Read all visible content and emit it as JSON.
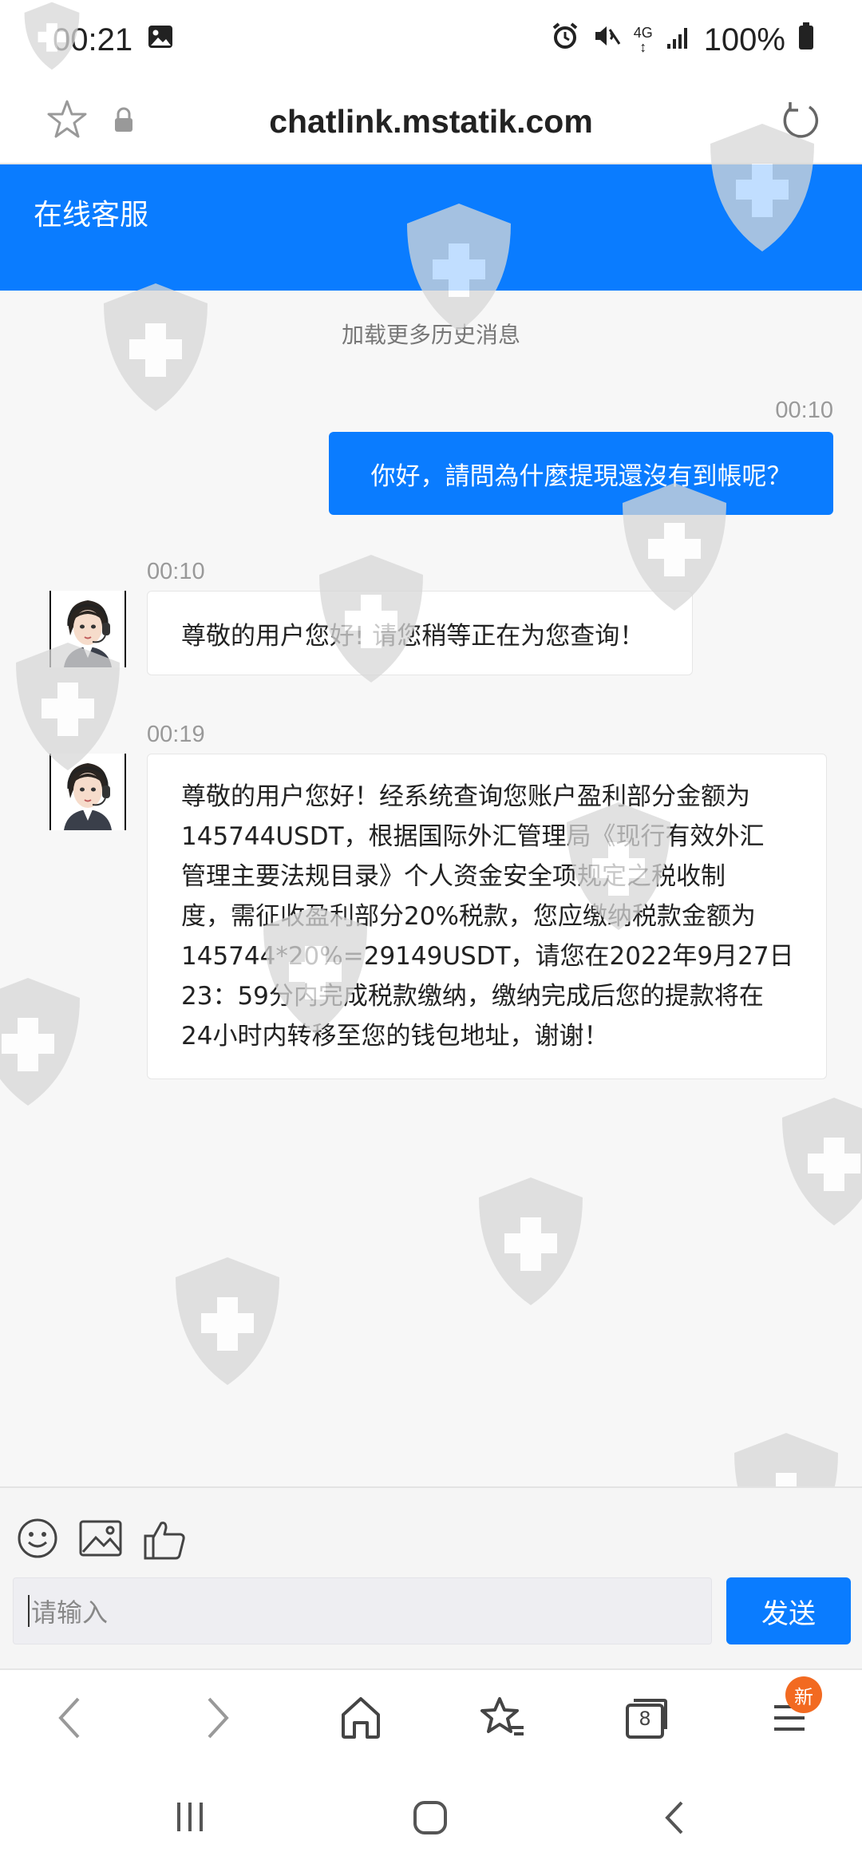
{
  "status_bar": {
    "time": "00:21",
    "network": "4G",
    "battery": "100%",
    "icons": [
      "image-icon",
      "alarm-icon",
      "mute-icon",
      "signal-icon",
      "battery-icon"
    ]
  },
  "browser": {
    "url": "chatlink.mstatik.com",
    "tab_count": "8",
    "menu_badge": "新"
  },
  "header": {
    "title": "在线客服"
  },
  "chat": {
    "load_more": "加载更多历史消息",
    "messages": [
      {
        "direction": "outgoing",
        "time": "00:10",
        "text": "你好，請問為什麼提現還沒有到帳呢？"
      },
      {
        "direction": "incoming",
        "time": "00:10",
        "text": "尊敬的用户您好! 请您稍等正在为您查询！"
      },
      {
        "direction": "incoming",
        "time": "00:19",
        "text": "尊敬的用户您好！经系统查询您账户盈利部分金额为\n145744USDT，根据国际外汇管理局《现行有效外汇\n管理主要法规目录》个人资金安全项规定之税收制\n度，需征收盈利部分20%税款，您应缴纳税款金额为\n145744*20%=29149USDT，请您在2022年9月27日\n23：59分内完成税款缴纳，缴纳完成后您的提款将在\n24小时内转移至您的钱包地址，谢谢！"
      }
    ]
  },
  "composer": {
    "placeholder": "请输入",
    "send_label": "发送",
    "tools": [
      "emoji-icon",
      "image-icon",
      "thumbs-up-icon"
    ]
  },
  "colors": {
    "accent": "#0a7cff",
    "badge": "#f26a21",
    "background": "#f7f7f7"
  }
}
